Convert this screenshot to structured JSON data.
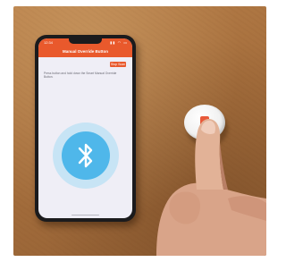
{
  "phone": {
    "status_time": "12:34",
    "status_icons": "▮▮ ◠ ▭",
    "nav_title": "Manual Override Button",
    "stop_label": "Stop Scan",
    "instructions": "Press button and hold down the Smart Manual Override Button."
  },
  "scene": {
    "wood_color": "#a66f3d",
    "accent_color": "#e9592c",
    "bluetooth_color": "#4fb7ea",
    "device_logo_color": "#e85a3a",
    "icons": [
      "bluetooth-icon",
      "device-logo-icon"
    ]
  }
}
